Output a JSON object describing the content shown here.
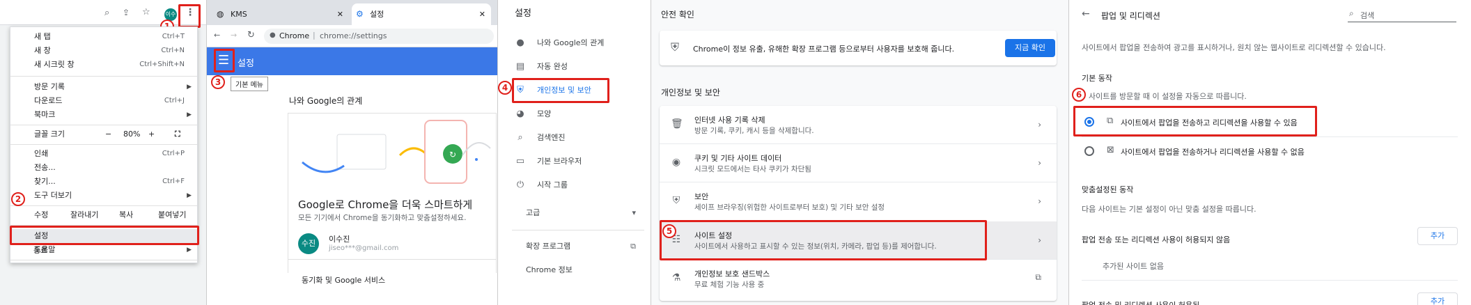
{
  "steps": [
    "1",
    "2",
    "3",
    "4",
    "5",
    "6"
  ],
  "menu": {
    "items": {
      "new_tab": {
        "label": "새 탭",
        "shortcut": "Ctrl+T"
      },
      "new_window": {
        "label": "새 창",
        "shortcut": "Ctrl+N"
      },
      "new_incognito": {
        "label": "새 시크릿 창",
        "shortcut": "Ctrl+Shift+N"
      },
      "history": {
        "label": "방문 기록"
      },
      "downloads": {
        "label": "다운로드",
        "shortcut": "Ctrl+J"
      },
      "bookmarks": {
        "label": "북마크"
      },
      "zoom": {
        "label": "글꼴 크기",
        "minus": "−",
        "value": "80%",
        "plus": "+"
      },
      "print": {
        "label": "인쇄",
        "shortcut": "Ctrl+P"
      },
      "cast": {
        "label": "전송..."
      },
      "find": {
        "label": "찾기...",
        "shortcut": "Ctrl+F"
      },
      "more_tools": {
        "label": "도구 더보기"
      },
      "edit": {
        "label": "수정",
        "cut": "잘라내기",
        "copy": "복사",
        "paste": "붙여넣기"
      },
      "settings": {
        "label": "설정"
      },
      "help": {
        "label": "도움말"
      },
      "exit": {
        "label": "종료"
      }
    },
    "avatar": "이수"
  },
  "browser": {
    "tabs": [
      {
        "title": "KMS"
      },
      {
        "title": "설정"
      }
    ],
    "url_site": "Chrome",
    "url_path": "chrome://settings",
    "header_title": "설정",
    "tooltip": "기본 메뉴",
    "section_title": "나와 Google의 관계",
    "promo_title": "Google로 Chrome을 더욱 스마트하게",
    "promo_sub": "모든 기기에서 Chrome을 동기화하고 맞춤설정하세요.",
    "user_initials": "수진",
    "user_name": "이수진",
    "user_email": "jiseo***@gmail.com",
    "sync_label": "동기화 및 Google 서비스"
  },
  "sidebar": {
    "title": "설정",
    "items": [
      {
        "label": "나와 Google의 관계",
        "icon": "person-icon"
      },
      {
        "label": "자동 완성",
        "icon": "clipboard-icon"
      },
      {
        "label": "개인정보 및 보안",
        "icon": "shield-icon"
      },
      {
        "label": "모양",
        "icon": "palette-icon"
      },
      {
        "label": "검색엔진",
        "icon": "search-icon"
      },
      {
        "label": "기본 브라우저",
        "icon": "browser-icon"
      },
      {
        "label": "시작 그룹",
        "icon": "power-icon"
      }
    ],
    "advanced": "고급",
    "extensions": "확장 프로그램",
    "about": "Chrome 정보"
  },
  "privacy": {
    "safety_title": "안전 확인",
    "safety_text": "Chrome이 정보 유출, 유해한 확장 프로그램 등으로부터 사용자를 보호해 줍니다.",
    "safety_button": "지금 확인",
    "section_title": "개인정보 및 보안",
    "rows": [
      {
        "title": "인터넷 사용 기록 삭제",
        "sub": "방문 기록, 쿠키, 캐시 등을 삭제합니다."
      },
      {
        "title": "쿠키 및 기타 사이트 데이터",
        "sub": "시크릿 모드에서는 타사 쿠키가 차단됨"
      },
      {
        "title": "보안",
        "sub": "세이프 브라우징(위험한 사이트로부터 보호) 및 기타 보안 설정"
      },
      {
        "title": "사이트 설정",
        "sub": "사이트에서 사용하고 표시할 수 있는 정보(위치, 카메라, 팝업 등)를 제어합니다."
      },
      {
        "title": "개인정보 보호 샌드박스",
        "sub": "무료 체험 기능 사용 중"
      }
    ]
  },
  "popups": {
    "title": "팝업 및 리디렉션",
    "search_placeholder": "검색",
    "description": "사이트에서 팝업을 전송하여 광고를 표시하거나, 원치 않는 웹사이트로 리디렉션할 수 있습니다.",
    "default_heading": "기본 동작",
    "default_sub": "사이트를 방문할 때 이 설정을 자동으로 따릅니다.",
    "option_allow": "사이트에서 팝업을 전송하고 리디렉션을 사용할 수 있음",
    "option_block": "사이트에서 팝업을 전송하거나 리디렉션을 사용할 수 없음",
    "custom_heading": "맞춤설정된 동작",
    "custom_sub": "다음 사이트는 기본 설정이 아닌 맞춤 설정을 따릅니다.",
    "not_allowed_label": "팝업 전송 또는 리디렉션 사용이 허용되지 않음",
    "add_label": "추가",
    "no_sites": "추가된 사이트 없음",
    "allowed_label": "팝업 전송 및 리디렉션 사용이 허용됨"
  }
}
